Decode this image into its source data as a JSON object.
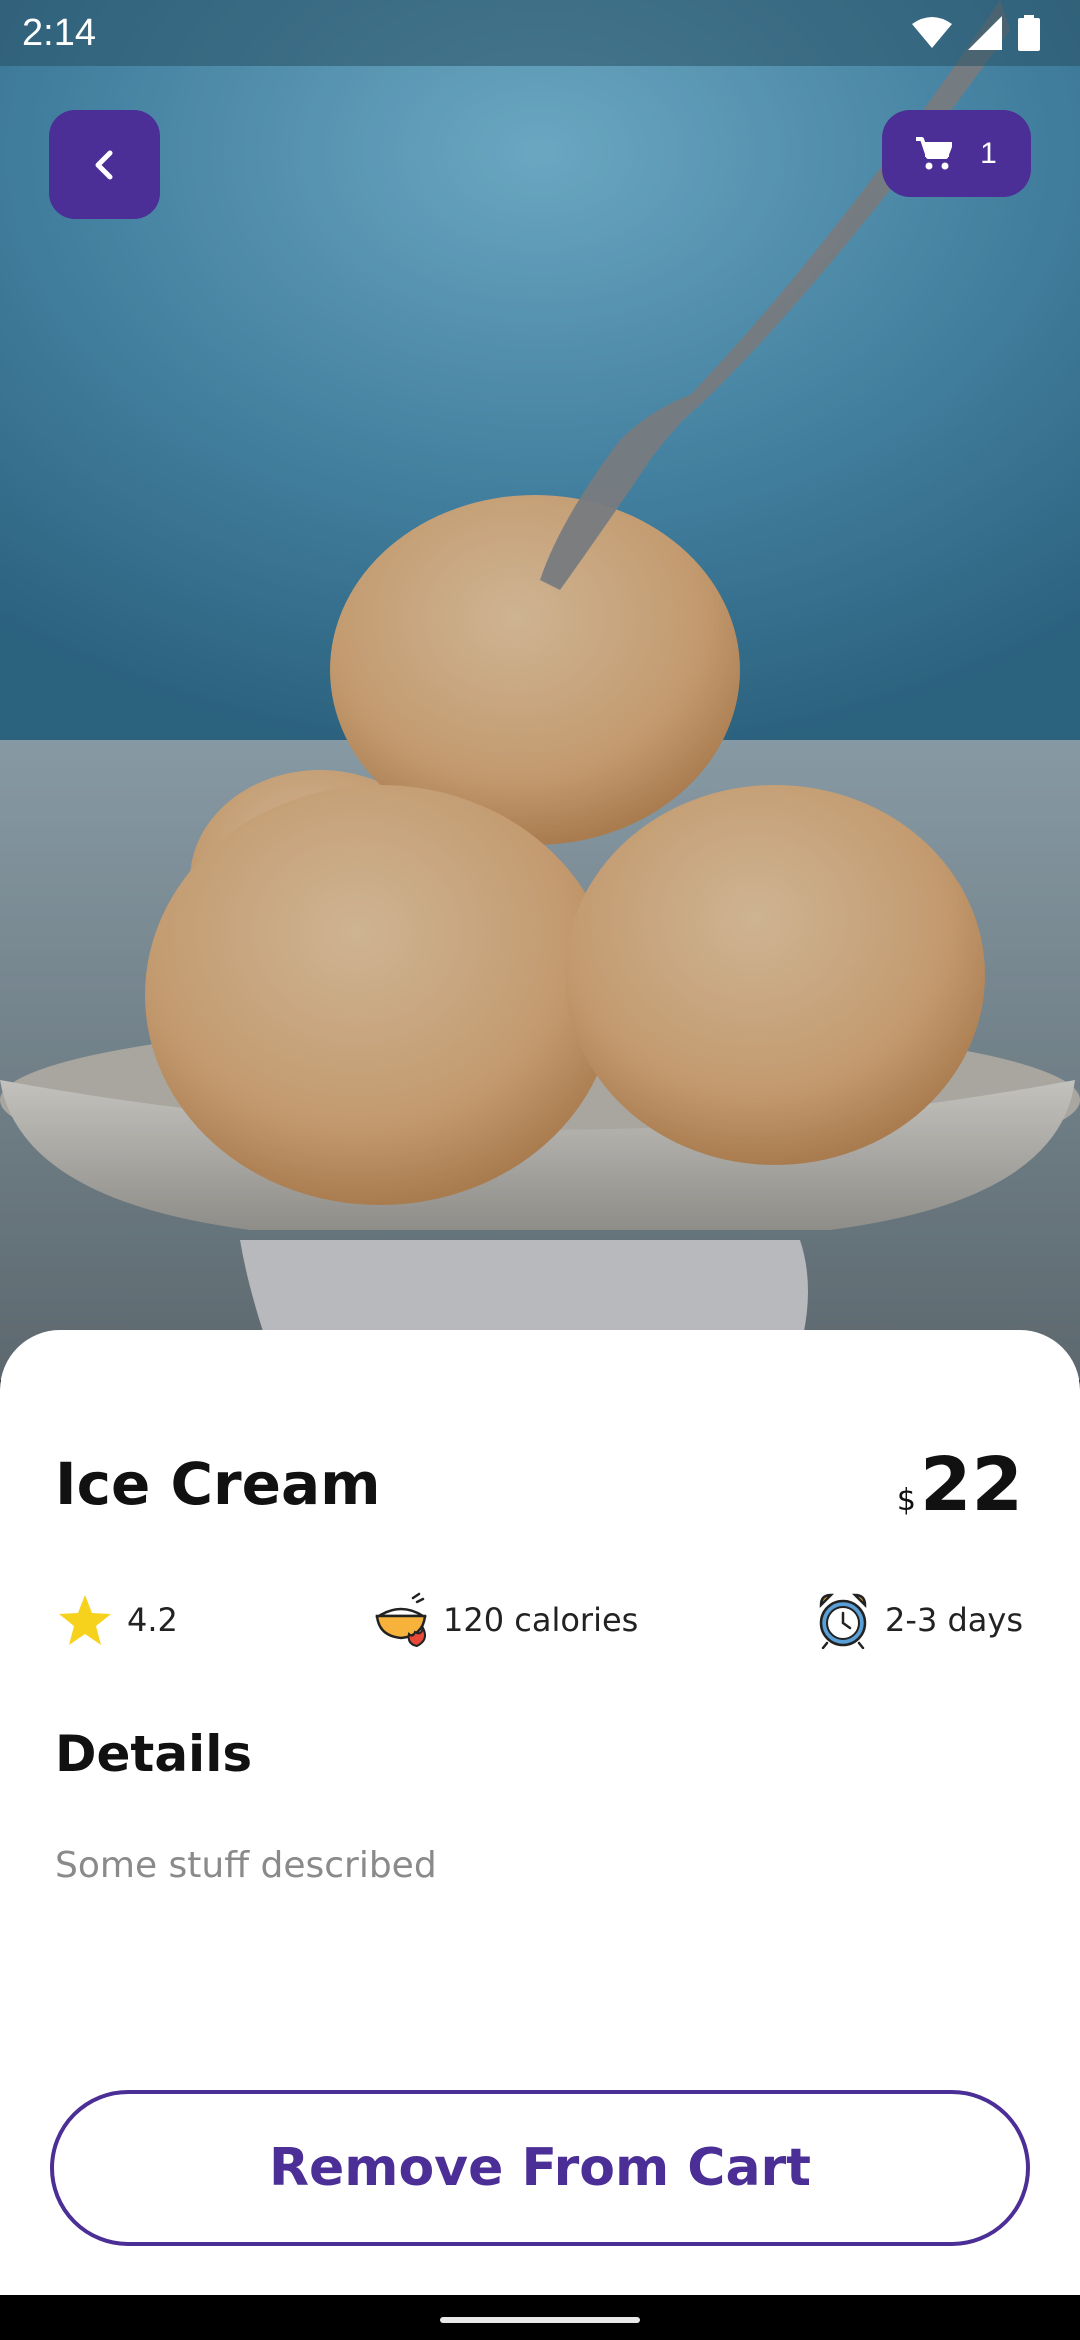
{
  "status_bar": {
    "time": "2:14"
  },
  "header": {
    "back_icon": "chevron-left-icon",
    "cart_icon": "shopping-cart-icon",
    "cart_count": "1"
  },
  "product": {
    "image_description_icon": "ice-cream-photo",
    "name": "Ice Cream",
    "currency": "$",
    "price": "22",
    "rating": "4.2",
    "calories": "120 calories",
    "delivery": "2-3 days",
    "details_heading": "Details",
    "details_text": "Some stuff described"
  },
  "actions": {
    "remove_label": "Remove From Cart"
  },
  "colors": {
    "accent": "#4b2e96",
    "star": "#f7d21c"
  }
}
